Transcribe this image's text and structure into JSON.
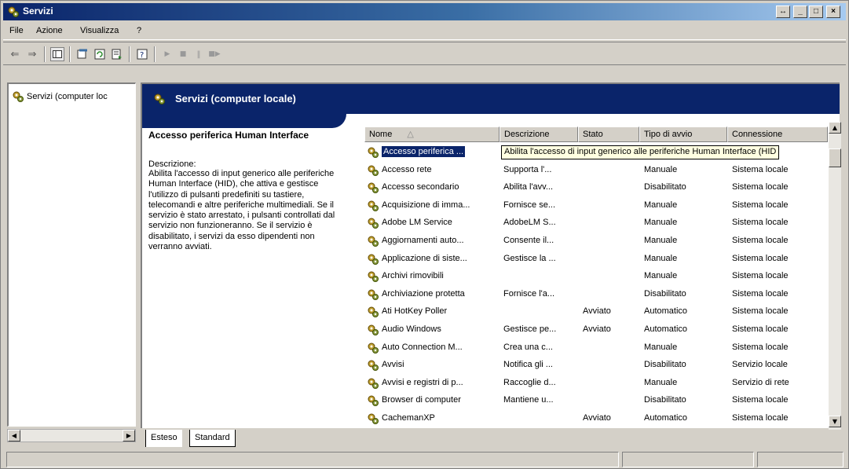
{
  "window": {
    "title": "Servizi"
  },
  "menu": [
    "File",
    "Azione",
    "Visualizza",
    "?"
  ],
  "toolbar": {
    "icons": [
      "back-icon",
      "forward-icon",
      "show-hide-tree-icon",
      "properties-icon",
      "refresh-icon",
      "export-list-icon",
      "help-icon",
      "start-service-icon",
      "stop-service-icon",
      "pause-service-icon",
      "restart-service-icon"
    ]
  },
  "tree": {
    "root_label": "Servizi (computer loc"
  },
  "header": {
    "title": "Servizi (computer locale)"
  },
  "description": {
    "service_title": "Accesso periferica Human Interface",
    "label": "Descrizione:",
    "body": "Abilita l'accesso di input generico alle periferiche Human Interface (HID), che attiva e gestisce l'utilizzo di pulsanti predefiniti su tastiere, telecomandi e altre periferiche multimediali. Se il servizio è stato arrestato, i pulsanti controllati dal servizio non funzioneranno. Se il servizio è disabilitato, i servizi da esso dipendenti non verranno avviati."
  },
  "columns": {
    "name": "Nome",
    "desc": "Descrizione",
    "status": "Stato",
    "startup": "Tipo di avvio",
    "logon": "Connessione"
  },
  "tooltip": "Abilita l'accesso di input generico alle periferiche Human Interface (HID",
  "rows": [
    {
      "name": "Accesso periferica ...",
      "desc": "",
      "status": "",
      "startup": "",
      "logon": "",
      "selected": true
    },
    {
      "name": "Accesso rete",
      "desc": "Supporta l'...",
      "status": "",
      "startup": "Manuale",
      "logon": "Sistema locale"
    },
    {
      "name": "Accesso secondario",
      "desc": "Abilita l'avv...",
      "status": "",
      "startup": "Disabilitato",
      "logon": "Sistema locale"
    },
    {
      "name": "Acquisizione di imma...",
      "desc": "Fornisce se...",
      "status": "",
      "startup": "Manuale",
      "logon": "Sistema locale"
    },
    {
      "name": "Adobe LM Service",
      "desc": "AdobeLM S...",
      "status": "",
      "startup": "Manuale",
      "logon": "Sistema locale"
    },
    {
      "name": "Aggiornamenti auto...",
      "desc": "Consente il...",
      "status": "",
      "startup": "Manuale",
      "logon": "Sistema locale"
    },
    {
      "name": "Applicazione di siste...",
      "desc": "Gestisce la ...",
      "status": "",
      "startup": "Manuale",
      "logon": "Sistema locale"
    },
    {
      "name": "Archivi rimovibili",
      "desc": "",
      "status": "",
      "startup": "Manuale",
      "logon": "Sistema locale"
    },
    {
      "name": "Archiviazione protetta",
      "desc": "Fornisce l'a...",
      "status": "",
      "startup": "Disabilitato",
      "logon": "Sistema locale"
    },
    {
      "name": "Ati HotKey Poller",
      "desc": "",
      "status": "Avviato",
      "startup": "Automatico",
      "logon": "Sistema locale"
    },
    {
      "name": "Audio Windows",
      "desc": "Gestisce pe...",
      "status": "Avviato",
      "startup": "Automatico",
      "logon": "Sistema locale"
    },
    {
      "name": "Auto Connection M...",
      "desc": "Crea una c...",
      "status": "",
      "startup": "Manuale",
      "logon": "Sistema locale"
    },
    {
      "name": "Avvisi",
      "desc": "Notifica gli ...",
      "status": "",
      "startup": "Disabilitato",
      "logon": "Servizio locale"
    },
    {
      "name": "Avvisi e registri di p...",
      "desc": "Raccoglie d...",
      "status": "",
      "startup": "Manuale",
      "logon": "Servizio di rete"
    },
    {
      "name": "Browser di computer",
      "desc": "Mantiene u...",
      "status": "",
      "startup": "Disabilitato",
      "logon": "Sistema locale"
    },
    {
      "name": "CachemanXP",
      "desc": "",
      "status": "Avviato",
      "startup": "Automatico",
      "logon": "Sistema locale"
    }
  ],
  "tabs": [
    "Esteso",
    "Standard"
  ],
  "colors": {
    "titlebar": "#0a246a",
    "selection": "#0a246a",
    "tooltip_bg": "#ffffe1",
    "chrome": "#d4d0c8"
  }
}
